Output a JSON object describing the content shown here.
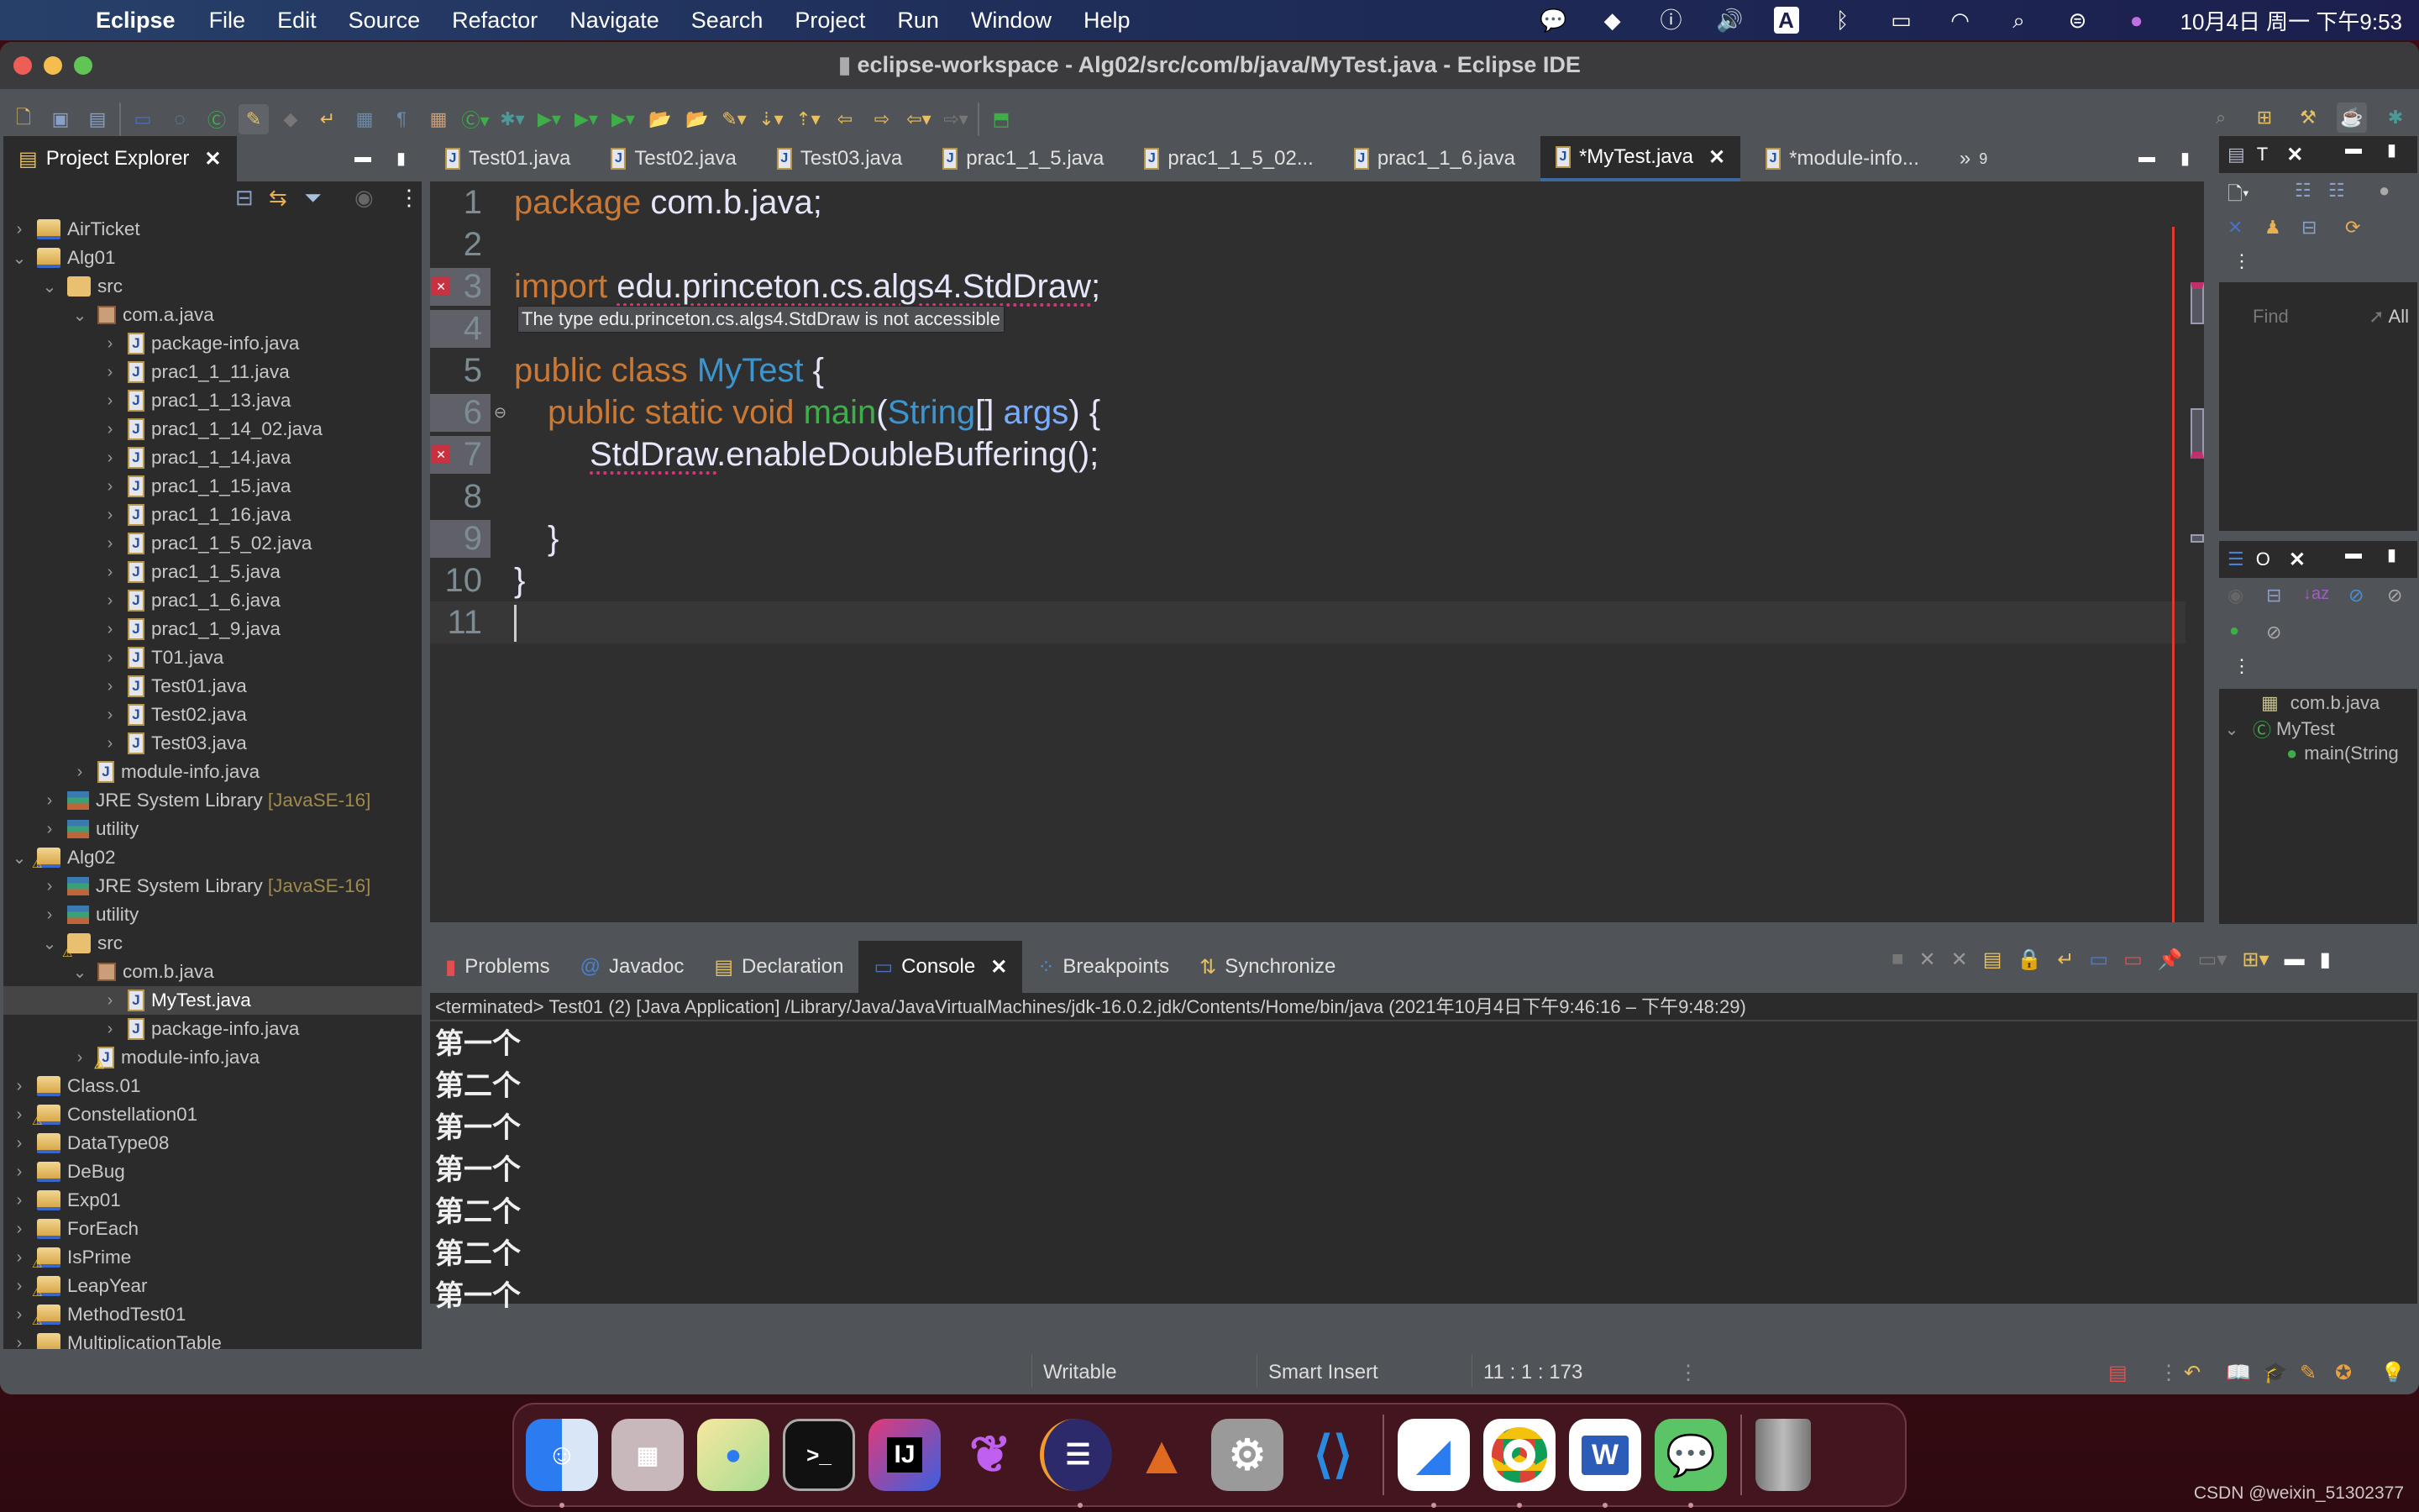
{
  "menubar": {
    "app_name": "Eclipse",
    "menus": [
      "File",
      "Edit",
      "Source",
      "Refactor",
      "Navigate",
      "Search",
      "Project",
      "Run",
      "Window",
      "Help"
    ],
    "status_icons": [
      "wechat-icon",
      "pen-icon",
      "accessibility-icon",
      "volume-icon",
      "input-source-icon",
      "bluetooth-icon",
      "battery-icon",
      "wifi-icon",
      "spotlight-icon",
      "control-center-icon",
      "siri-icon"
    ],
    "input_source": "A",
    "clock": "10月4日 周一 下午9:53"
  },
  "window": {
    "title": "eclipse-workspace - Alg02/src/com/b/java/MyTest.java - Eclipse IDE"
  },
  "project_explorer": {
    "title": "Project Explorer",
    "tree": [
      {
        "label": "AirTicket",
        "level": 0,
        "type": "project",
        "expanded": false
      },
      {
        "label": "Alg01",
        "level": 0,
        "type": "project",
        "expanded": true
      },
      {
        "label": "src",
        "level": 1,
        "type": "src",
        "expanded": true
      },
      {
        "label": "com.a.java",
        "level": 2,
        "type": "package",
        "expanded": true
      },
      {
        "label": "package-info.java",
        "level": 3,
        "type": "java"
      },
      {
        "label": "prac1_1_11.java",
        "level": 3,
        "type": "java"
      },
      {
        "label": "prac1_1_13.java",
        "level": 3,
        "type": "java"
      },
      {
        "label": "prac1_1_14_02.java",
        "level": 3,
        "type": "java"
      },
      {
        "label": "prac1_1_14.java",
        "level": 3,
        "type": "java"
      },
      {
        "label": "prac1_1_15.java",
        "level": 3,
        "type": "java"
      },
      {
        "label": "prac1_1_16.java",
        "level": 3,
        "type": "java"
      },
      {
        "label": "prac1_1_5_02.java",
        "level": 3,
        "type": "java"
      },
      {
        "label": "prac1_1_5.java",
        "level": 3,
        "type": "java"
      },
      {
        "label": "prac1_1_6.java",
        "level": 3,
        "type": "java"
      },
      {
        "label": "prac1_1_9.java",
        "level": 3,
        "type": "java"
      },
      {
        "label": "T01.java",
        "level": 3,
        "type": "java"
      },
      {
        "label": "Test01.java",
        "level": 3,
        "type": "java"
      },
      {
        "label": "Test02.java",
        "level": 3,
        "type": "java"
      },
      {
        "label": "Test03.java",
        "level": 3,
        "type": "java"
      },
      {
        "label": "module-info.java",
        "level": 2,
        "type": "java"
      },
      {
        "label": "JRE System Library",
        "tag": "[JavaSE-16]",
        "level": 1,
        "type": "lib"
      },
      {
        "label": "utility",
        "level": 1,
        "type": "lib"
      },
      {
        "label": "Alg02",
        "level": 0,
        "type": "project",
        "expanded": true,
        "warning": true
      },
      {
        "label": "JRE System Library",
        "tag": "[JavaSE-16]",
        "level": 1,
        "type": "lib"
      },
      {
        "label": "utility",
        "level": 1,
        "type": "lib"
      },
      {
        "label": "src",
        "level": 1,
        "type": "src",
        "expanded": true,
        "warning": true
      },
      {
        "label": "com.b.java",
        "level": 2,
        "type": "package",
        "expanded": true
      },
      {
        "label": "MyTest.java",
        "level": 3,
        "type": "java",
        "selected": true
      },
      {
        "label": "package-info.java",
        "level": 3,
        "type": "java"
      },
      {
        "label": "module-info.java",
        "level": 2,
        "type": "java",
        "warning": true
      },
      {
        "label": "Class.01",
        "level": 0,
        "type": "project"
      },
      {
        "label": "Constellation01",
        "level": 0,
        "type": "project",
        "warning": true
      },
      {
        "label": "DataType08",
        "level": 0,
        "type": "project"
      },
      {
        "label": "DeBug",
        "level": 0,
        "type": "project"
      },
      {
        "label": "Exp01",
        "level": 0,
        "type": "project"
      },
      {
        "label": "ForEach",
        "level": 0,
        "type": "project"
      },
      {
        "label": "IsPrime",
        "level": 0,
        "type": "project",
        "warning": true
      },
      {
        "label": "LeapYear",
        "level": 0,
        "type": "project",
        "warning": true
      },
      {
        "label": "MethodTest01",
        "level": 0,
        "type": "project",
        "warning": true
      },
      {
        "label": "MultiplicationTable",
        "level": 0,
        "type": "project"
      }
    ]
  },
  "editor": {
    "tabs": [
      {
        "label": "Test01.java",
        "active": false
      },
      {
        "label": "Test02.java",
        "active": false
      },
      {
        "label": "Test03.java",
        "active": false
      },
      {
        "label": "prac1_1_5.java",
        "active": false
      },
      {
        "label": "prac1_1_5_02...",
        "active": false
      },
      {
        "label": "prac1_1_6.java",
        "active": false
      },
      {
        "label": "*MyTest.java",
        "active": true
      },
      {
        "label": "*module-info...",
        "active": false
      }
    ],
    "overflow_count": "9",
    "tooltip": "The type edu.princeton.cs.algs4.StdDraw is not accessible",
    "lines": {
      "l1_kw": "package",
      "l1_rest": " com.b.java;",
      "l3_kw": "import",
      "l3_rest": "edu.princeton.cs.algs4.StdDraw",
      "l3_end": ";",
      "l5_kw": "public class ",
      "l5_cls": "MyTest",
      "l5_end": " {",
      "l6_kw": "public static void ",
      "l6_mth": "main",
      "l6_p1": "(",
      "l6_typ": "String",
      "l6_p2": "[] ",
      "l6_par": "args",
      "l6_end": ") {",
      "l7_err": "StdDraw",
      "l7_rest": ".enableDoubleBuffering();",
      "l9": "}",
      "l10": "}"
    },
    "line_numbers": [
      "1",
      "2",
      "3",
      "4",
      "5",
      "6",
      "7",
      "8",
      "9",
      "10",
      "11"
    ]
  },
  "task_list": {
    "tab_label": "T",
    "find_placeholder": "Find",
    "all_label": "All"
  },
  "outline": {
    "tab_label": "O",
    "items": [
      "com.b.java",
      "MyTest",
      "main(String"
    ]
  },
  "console": {
    "tabs": [
      "Problems",
      "Javadoc",
      "Declaration",
      "Console",
      "Breakpoints",
      "Synchronize"
    ],
    "active_tab": "Console",
    "terminated_line": "<terminated> Test01 (2) [Java Application] /Library/Java/JavaVirtualMachines/jdk-16.0.2.jdk/Contents/Home/bin/java  (2021年10月4日下午9:46:16 – 下午9:48:29)",
    "output": [
      "第一个",
      "第二个",
      "第一个",
      "第一个",
      "第二个",
      "第二个",
      "第一个"
    ]
  },
  "statusbar": {
    "mode": "Writable",
    "insert": "Smart Insert",
    "position": "11 : 1 : 173"
  },
  "dock": {
    "apps": [
      "Finder",
      "Launchpad",
      "Maps",
      "Terminal",
      "IntelliJ IDEA",
      "Kotlin",
      "Eclipse",
      "MATLAB",
      "System Preferences",
      "VS Code",
      "Lark",
      "Chrome",
      "Word",
      "WeChat",
      "Trash"
    ]
  },
  "watermark": "CSDN @weixin_51302377"
}
